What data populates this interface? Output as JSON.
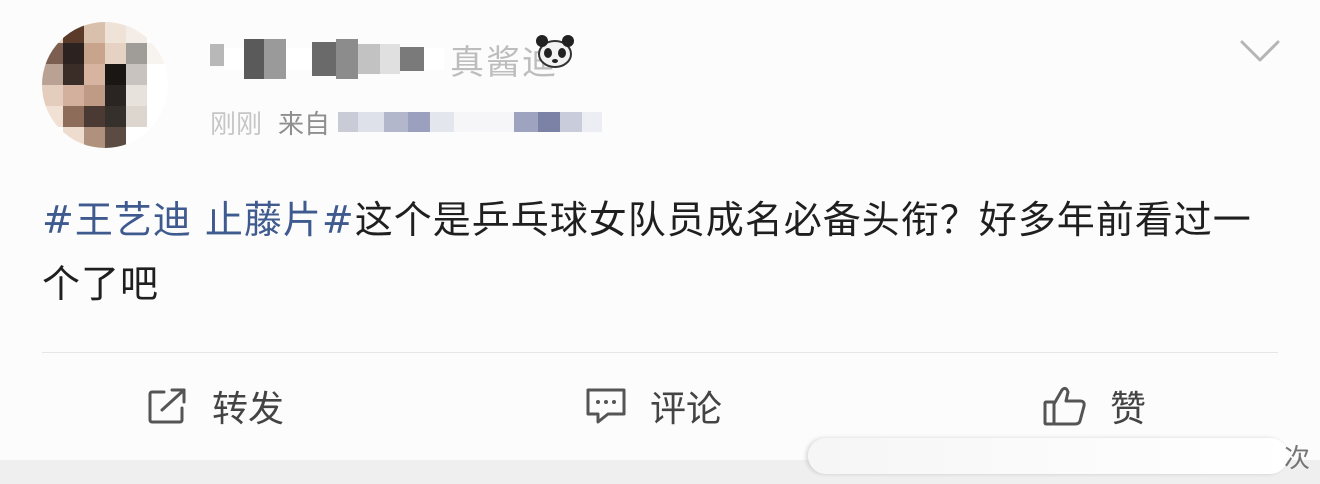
{
  "post": {
    "username_visible_fragment": "真酱迪",
    "meta": {
      "time_fragment": "刚刚",
      "source_label": "来自"
    },
    "content": {
      "topic": "#王艺迪 止藤片#",
      "text": "这个是乒乓球女队员成名必备头衔？好多年前看过一个了吧"
    }
  },
  "actions": {
    "repost_label": "转发",
    "comment_label": "评论",
    "like_label": "赞"
  },
  "bottom": {
    "pill_suffix": "次"
  },
  "icons": {
    "repost": "share-edit-icon",
    "comment": "comment-bubble-icon",
    "like": "thumbs-up-icon",
    "expand": "chevron-down-icon",
    "emoji": "panda-icon"
  },
  "colors": {
    "topic": "#3e5a8e",
    "text": "#1f1f1f",
    "action": "#444444",
    "background": "#fcfcfc"
  }
}
